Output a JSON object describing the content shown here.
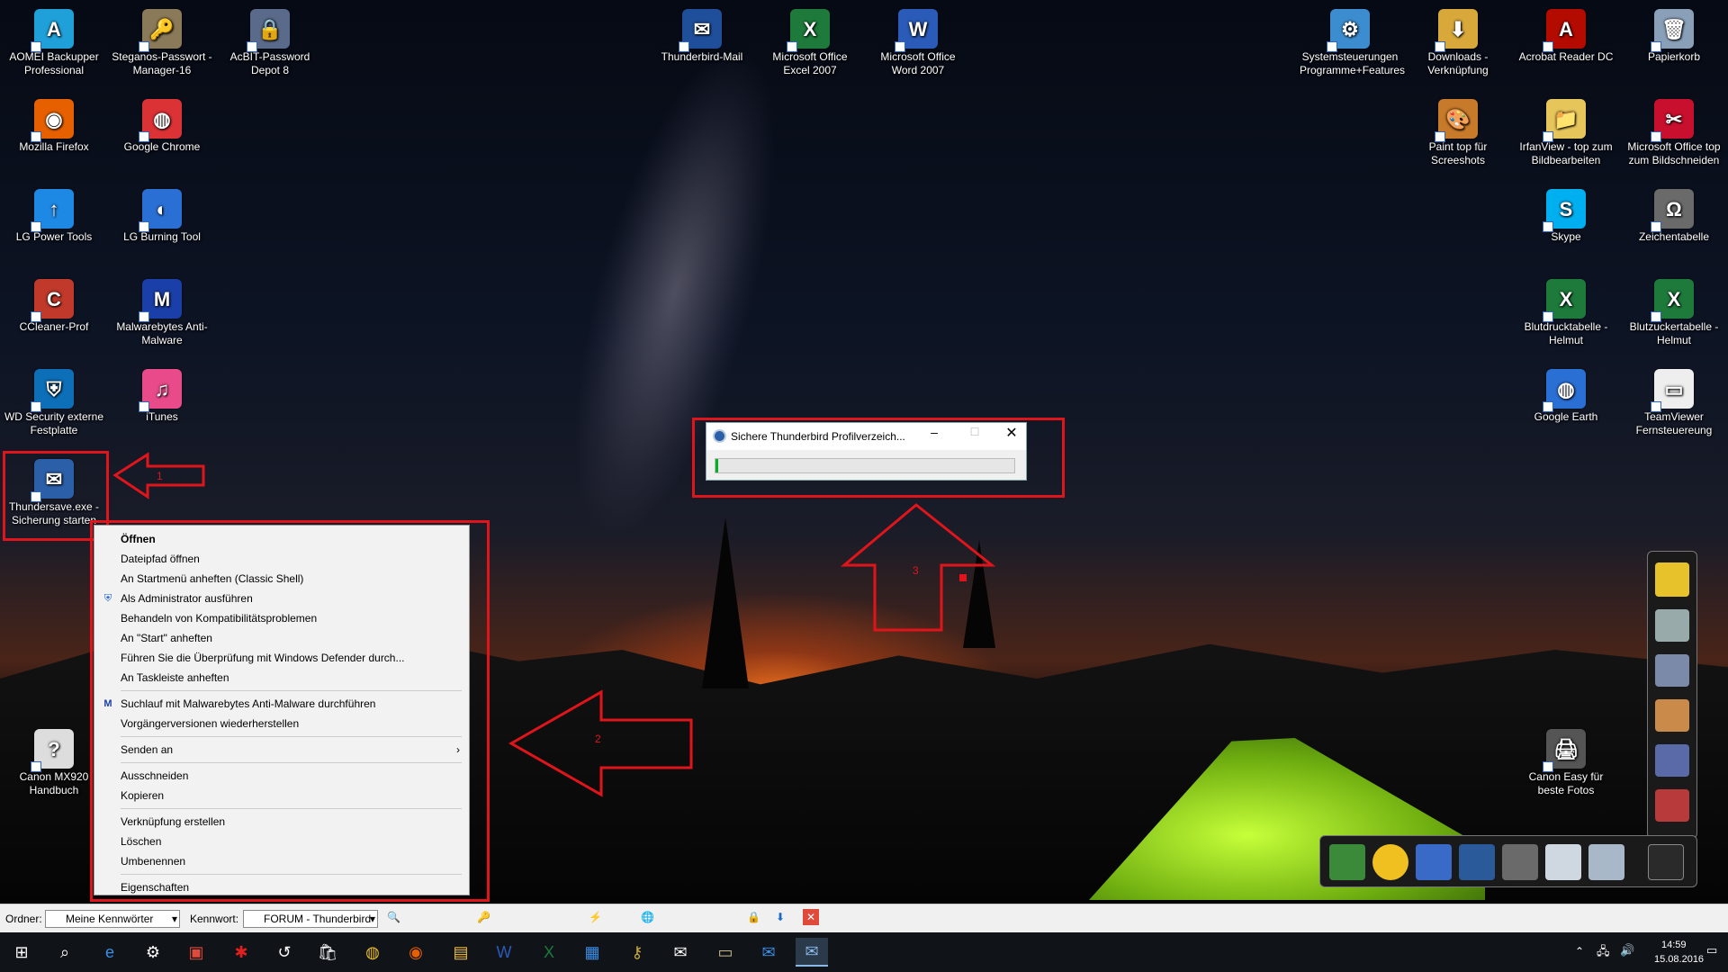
{
  "desktop_icons": [
    {
      "label": "AOMEI Backupper Professional",
      "glyph": "A",
      "color": "#1fa0d8"
    },
    {
      "label": "Steganos-Passwort - Manager-16",
      "glyph": "🔑",
      "color": "#8a7a5a"
    },
    {
      "label": "AcBIT-Password Depot 8",
      "glyph": "🔒",
      "color": "#5a6a8a"
    },
    {
      "label": "Mozilla Firefox",
      "glyph": "◉",
      "color": "#e66000"
    },
    {
      "label": "Google Chrome",
      "glyph": "◍",
      "color": "#db3236"
    },
    {
      "label": "LG Power Tools",
      "glyph": "↑",
      "color": "#1e88e5"
    },
    {
      "label": "LG Burning Tool",
      "glyph": "◐",
      "color": "#2a6fd4"
    },
    {
      "label": "CCleaner-Prof",
      "glyph": "C",
      "color": "#c0392b"
    },
    {
      "label": "Malwarebytes Anti-Malware",
      "glyph": "M",
      "color": "#1a3fa8"
    },
    {
      "label": "WD Security externe Festplatte",
      "glyph": "⛨",
      "color": "#0d6fb8"
    },
    {
      "label": "iTunes",
      "glyph": "♫",
      "color": "#e84a8a"
    },
    {
      "label": "Thundersave.exe - Sicherung starten",
      "glyph": "✉",
      "color": "#2b5fa8"
    },
    {
      "label": "Canon MX920 Handbuch",
      "glyph": "?",
      "color": "#dddddd"
    },
    {
      "label": "Thunderbird-Mail",
      "glyph": "✉",
      "color": "#1f4e9a"
    },
    {
      "label": "Microsoft Office Excel 2007",
      "glyph": "X",
      "color": "#1d7a3a"
    },
    {
      "label": "Microsoft Office Word 2007",
      "glyph": "W",
      "color": "#2a5bb8"
    },
    {
      "label": "Systemsteuerungen Programme+Features",
      "glyph": "⚙",
      "color": "#3c8dcf"
    },
    {
      "label": "Downloads - Verknüpfung",
      "glyph": "⬇",
      "color": "#d8a93a"
    },
    {
      "label": "Acrobat Reader DC",
      "glyph": "A",
      "color": "#b30b00"
    },
    {
      "label": "Papierkorb",
      "glyph": "🗑",
      "color": "#8aa0b8"
    },
    {
      "label": "Paint top für Screeshots",
      "glyph": "🎨",
      "color": "#c77a2a"
    },
    {
      "label": "IrfanView - top zum Bildbearbeiten",
      "glyph": "📁",
      "color": "#e6c65a"
    },
    {
      "label": "Microsoft Office top zum Bildschneiden",
      "glyph": "✂",
      "color": "#c8102e"
    },
    {
      "label": "Skype",
      "glyph": "S",
      "color": "#00aff0"
    },
    {
      "label": "Zeichentabelle",
      "glyph": "Ω",
      "color": "#6a6a6a"
    },
    {
      "label": "Blutdrucktabelle -Helmut",
      "glyph": "X",
      "color": "#1d7a3a"
    },
    {
      "label": "Blutzuckertabelle -Helmut",
      "glyph": "X",
      "color": "#1d7a3a"
    },
    {
      "label": "Google Earth",
      "glyph": "◍",
      "color": "#2a6fd4"
    },
    {
      "label": "TeamViewer Fernsteuereung",
      "glyph": "▭",
      "color": "#eeeeee"
    },
    {
      "label": "Canon Easy für beste Fotos",
      "glyph": "🖨",
      "color": "#555555"
    }
  ],
  "context_menu": {
    "items": [
      "Öffnen",
      "Dateipfad öffnen",
      "An Startmenü anheften (Classic Shell)",
      "Als Administrator ausführen",
      "Behandeln von Kompatibilitätsproblemen",
      "An \"Start\" anheften",
      "Führen Sie die Überprüfung mit Windows Defender durch...",
      "An Taskleiste anheften",
      "Suchlauf mit Malwarebytes Anti-Malware durchführen",
      "Vorgängerversionen wiederherstellen",
      "Senden an",
      "Ausschneiden",
      "Kopieren",
      "Verknüpfung erstellen",
      "Löschen",
      "Umbenennen",
      "Eigenschaften"
    ]
  },
  "progress_dialog": {
    "title": "Sichere Thunderbird Profilverzeich...",
    "progress": 0.01,
    "accent": "#06b025"
  },
  "annotations": [
    "1",
    "2",
    "3"
  ],
  "password_toolbar": {
    "folder_label": "Ordner:",
    "folder_value": "Meine Kennwörter",
    "password_label": "Kennwort:",
    "password_value": "FORUM - Thunderbird"
  },
  "clock": {
    "time": "14:59",
    "date": "15.08.2016"
  },
  "highlight_color": "#e0151b"
}
